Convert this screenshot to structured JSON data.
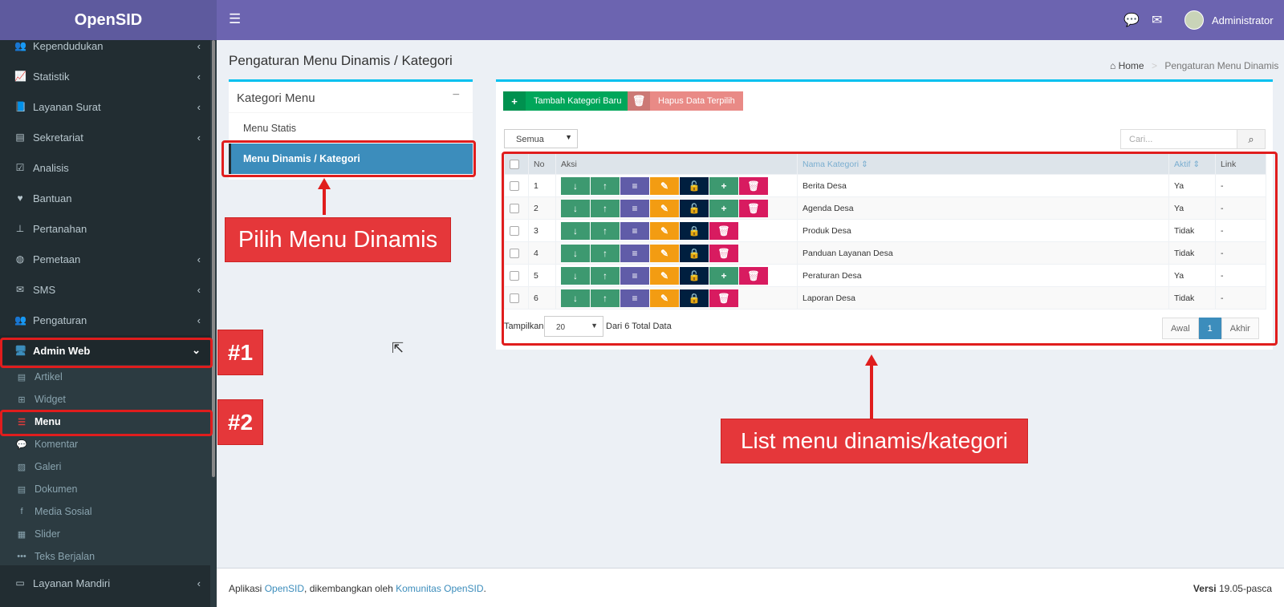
{
  "app": {
    "logo": "OpenSID"
  },
  "topbar": {
    "toggle_icon": "bars-icon",
    "user": "Administrator"
  },
  "sidebar": {
    "items": [
      {
        "label": "Kependudukan",
        "icon": "users-icon",
        "chev": "‹"
      },
      {
        "label": "Statistik",
        "icon": "chart-line-icon",
        "chev": "‹"
      },
      {
        "label": "Layanan Surat",
        "icon": "book-icon",
        "chev": "‹"
      },
      {
        "label": "Sekretariat",
        "icon": "archive-icon",
        "chev": "‹"
      },
      {
        "label": "Analisis",
        "icon": "check-square-icon",
        "chev": ""
      },
      {
        "label": "Bantuan",
        "icon": "heart-icon",
        "chev": ""
      },
      {
        "label": "Pertanahan",
        "icon": "map-signs-icon",
        "chev": ""
      },
      {
        "label": "Pemetaan",
        "icon": "globe-icon",
        "chev": "‹"
      },
      {
        "label": "SMS",
        "icon": "envelope-icon",
        "chev": "‹"
      },
      {
        "label": "Pengaturan",
        "icon": "users-cog-icon",
        "chev": "‹"
      },
      {
        "label": "Admin Web",
        "icon": "desktop-icon",
        "chev": "⌄"
      }
    ],
    "subitems": [
      {
        "label": "Artikel",
        "icon": "file-icon"
      },
      {
        "label": "Widget",
        "icon": "windows-icon"
      },
      {
        "label": "Menu",
        "icon": "bars-icon"
      },
      {
        "label": "Komentar",
        "icon": "comments-icon"
      },
      {
        "label": "Galeri",
        "icon": "image-icon"
      },
      {
        "label": "Dokumen",
        "icon": "file-text-icon"
      },
      {
        "label": "Media Sosial",
        "icon": "facebook-icon"
      },
      {
        "label": "Slider",
        "icon": "film-icon"
      },
      {
        "label": "Teks Berjalan",
        "icon": "ellipsis-icon"
      }
    ],
    "bottom": {
      "label": "Layanan Mandiri",
      "icon": "inbox-icon",
      "chev": "‹"
    }
  },
  "page": {
    "title": "Pengaturan Menu Dinamis / Kategori",
    "breadcrumb": {
      "home": "Home",
      "current": "Pengaturan Menu Dinamis"
    }
  },
  "left_box": {
    "title": "Kategori Menu",
    "collapse": "−",
    "items": [
      "Menu Statis",
      "Menu Dinamis / Kategori"
    ]
  },
  "toolbar": {
    "add_label": "Tambah Kategori Baru",
    "delete_label": "Hapus Data Terpilih",
    "filter_value": "Semua",
    "search_placeholder": "Cari..."
  },
  "table": {
    "headers": {
      "no": "No",
      "aksi": "Aksi",
      "nama": "Nama Kategori",
      "aktif": "Aktif",
      "link": "Link"
    },
    "rows": [
      {
        "no": "1",
        "nama": "Berita Desa",
        "aktif": "Ya",
        "link": "-"
      },
      {
        "no": "2",
        "nama": "Agenda Desa",
        "aktif": "Ya",
        "link": "-"
      },
      {
        "no": "3",
        "nama": "Produk Desa",
        "aktif": "Tidak",
        "link": "-"
      },
      {
        "no": "4",
        "nama": "Panduan Layanan Desa",
        "aktif": "Tidak",
        "link": "-"
      },
      {
        "no": "5",
        "nama": "Peraturan Desa",
        "aktif": "Ya",
        "link": "-"
      },
      {
        "no": "6",
        "nama": "Laporan Desa",
        "aktif": "Tidak",
        "link": "-"
      }
    ]
  },
  "pagination": {
    "show_label": "Tampilkan",
    "per_page": "20",
    "total_label": "Dari 6 Total Data",
    "first": "Awal",
    "page": "1",
    "last": "Akhir"
  },
  "footer": {
    "prefix": "Aplikasi ",
    "app_link": "OpenSID",
    "middle": ", dikembangkan oleh ",
    "community_link": "Komunitas OpenSID",
    "suffix": ".",
    "version_label": "Versi ",
    "version": "19.05-pasca"
  },
  "annotations": {
    "callout_menu": "Pilih Menu Dinamis",
    "callout_step1": "#1",
    "callout_step2": "#2",
    "callout_list": "List menu dinamis/kategori"
  },
  "colors": {
    "header": "#6c64b0",
    "sidebar": "#222d32",
    "accent": "#3c8dbc",
    "annotation_red": "#e01d1d"
  }
}
